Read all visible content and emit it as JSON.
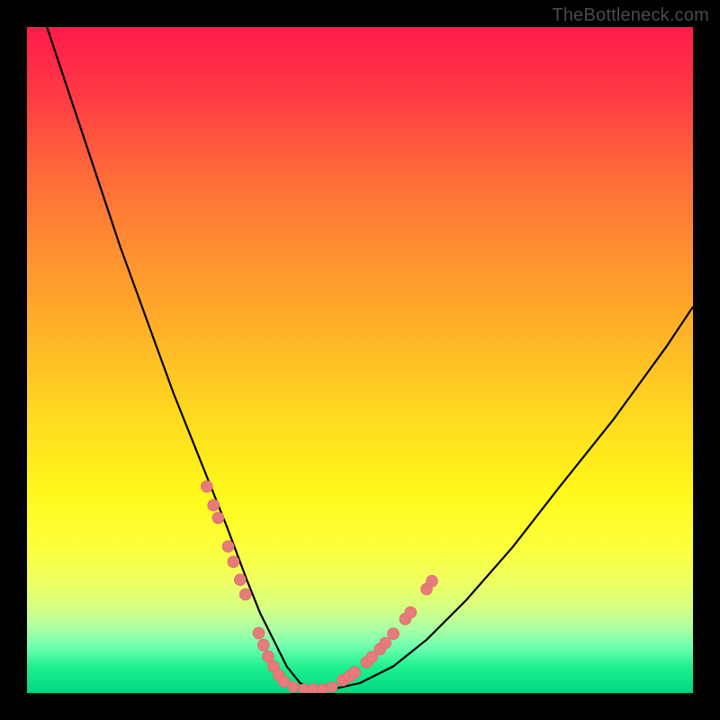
{
  "watermark": "TheBottleneck.com",
  "chart_data": {
    "type": "line",
    "title": "",
    "xlabel": "",
    "ylabel": "",
    "xlim": [
      0,
      100
    ],
    "ylim": [
      0,
      100
    ],
    "grid": false,
    "series": [
      {
        "name": "bottleneck-curve",
        "x": [
          3,
          6,
          10,
          14,
          18,
          22,
          26,
          30,
          33,
          35,
          37,
          39,
          41,
          43,
          46,
          50,
          55,
          60,
          66,
          73,
          80,
          88,
          96,
          100
        ],
        "y": [
          100,
          91,
          79,
          67,
          56,
          45,
          35,
          25,
          17,
          12,
          8,
          4,
          1.5,
          0.6,
          0.6,
          1.5,
          4,
          8,
          14,
          22,
          31,
          41,
          52,
          58
        ]
      }
    ],
    "markers": {
      "left_cluster_x": [
        27.0,
        28.0,
        28.7,
        30.2,
        31.0,
        32.0,
        32.8,
        34.8,
        35.5,
        36.2,
        37.0,
        37.8,
        38.6
      ],
      "left_cluster_y": [
        31.0,
        28.2,
        26.3,
        22.0,
        19.7,
        17.0,
        14.8,
        9.0,
        7.2,
        5.5,
        4.0,
        2.7,
        1.7
      ],
      "right_cluster_x": [
        47.4,
        48.4,
        49.2,
        51.0,
        51.8,
        53.0,
        53.8,
        55.0,
        56.8,
        57.6,
        60.0,
        60.8
      ],
      "right_cluster_y": [
        1.9,
        2.5,
        3.1,
        4.6,
        5.4,
        6.6,
        7.5,
        8.9,
        11.1,
        12.1,
        15.6,
        16.8
      ],
      "bottom_cluster_x": [
        40.0,
        41.6,
        43.0,
        44.4,
        45.8
      ],
      "bottom_cluster_y": [
        0.9,
        0.6,
        0.6,
        0.6,
        0.9
      ]
    },
    "colors": {
      "curve": "#000000",
      "marker_fill": "#e77a7a",
      "marker_stroke": "#d86a6a"
    }
  }
}
